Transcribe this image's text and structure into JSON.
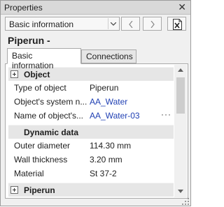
{
  "window": {
    "title": "Properties",
    "close_glyph": "✕"
  },
  "toolbar": {
    "combo_value": "Basic information",
    "back_icon": "chevron-left-icon",
    "forward_icon": "chevron-right-icon",
    "export_icon": "excel-export-icon"
  },
  "object": {
    "title": "Piperun -"
  },
  "tabs": [
    {
      "label": "Basic information",
      "active": true
    },
    {
      "label": "Connections",
      "active": false
    }
  ],
  "sections": [
    {
      "title": "Object",
      "expandable": true,
      "rows": [
        {
          "name": "Type of object",
          "value": "Piperun",
          "link": false
        },
        {
          "name": "Object's system n...",
          "value": "AA_Water",
          "link": true
        },
        {
          "name": "Name of object's...",
          "value": "AA_Water-03",
          "link": true,
          "more": "···"
        }
      ]
    },
    {
      "title": "Dynamic data",
      "expandable": false,
      "rows": [
        {
          "name": "Outer diameter",
          "value": "114.30 mm",
          "link": false
        },
        {
          "name": "Wall thickness",
          "value": "3.20 mm",
          "link": false
        },
        {
          "name": "Material",
          "value": "St 37-2",
          "link": false
        }
      ]
    },
    {
      "title": "Piperun",
      "expandable": true,
      "rows": []
    }
  ],
  "colors": {
    "link": "#1f3fb3",
    "section_bg": "#e6e6e6",
    "titlebar_bg": "#d9d9d9"
  }
}
